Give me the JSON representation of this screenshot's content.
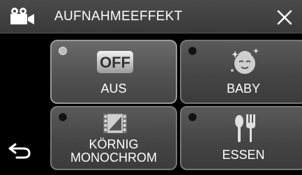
{
  "header": {
    "title": "AUFNAHMEEFFEKT",
    "mode_icon": "video-camera-icon",
    "close_icon": "close-icon"
  },
  "sidebar": {
    "back_icon": "back-arrow-icon"
  },
  "options": [
    {
      "label": "AUS",
      "icon": "off-icon",
      "icon_text": "OFF",
      "selected": true
    },
    {
      "label": "BABY",
      "icon": "baby-icon",
      "selected": false
    },
    {
      "label_line1": "KÖRNIG",
      "label_line2": "MONOCHROM",
      "icon": "film-monochrome-icon",
      "selected": false
    },
    {
      "label": "ESSEN",
      "icon": "spoon-fork-icon",
      "selected": false
    }
  ],
  "colors": {
    "header_bg": "#424242",
    "tile_bg": "#4a4a4a",
    "tile_border": "#777777",
    "radio_on": "#bdbdbd",
    "radio_off": "#111111"
  }
}
